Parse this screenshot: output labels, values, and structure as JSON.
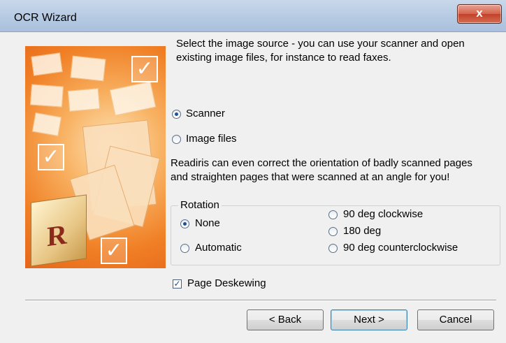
{
  "window": {
    "title": "OCR Wizard",
    "close_label": "x"
  },
  "intro": {
    "line1": "Select the image source - you can use your scanner and open",
    "line2": "existing image files, for instance to read faxes."
  },
  "source": {
    "options": [
      {
        "label": "Scanner",
        "selected": true
      },
      {
        "label": "Image files",
        "selected": false
      }
    ]
  },
  "info": {
    "line1": "Readiris can even correct the orientation of badly scanned pages",
    "line2": "and straighten pages that were scanned at an angle for you!"
  },
  "rotation": {
    "title": "Rotation",
    "options": [
      {
        "label": "None",
        "selected": true
      },
      {
        "label": "Automatic",
        "selected": false
      },
      {
        "label": "90 deg clockwise",
        "selected": false
      },
      {
        "label": "180 deg",
        "selected": false
      },
      {
        "label": "90 deg counterclockwise",
        "selected": false
      }
    ]
  },
  "deskew": {
    "label": "Page Deskewing",
    "checked": true
  },
  "buttons": {
    "back": "< Back",
    "next": "Next >",
    "cancel": "Cancel"
  },
  "logo": {
    "letter": "R"
  }
}
